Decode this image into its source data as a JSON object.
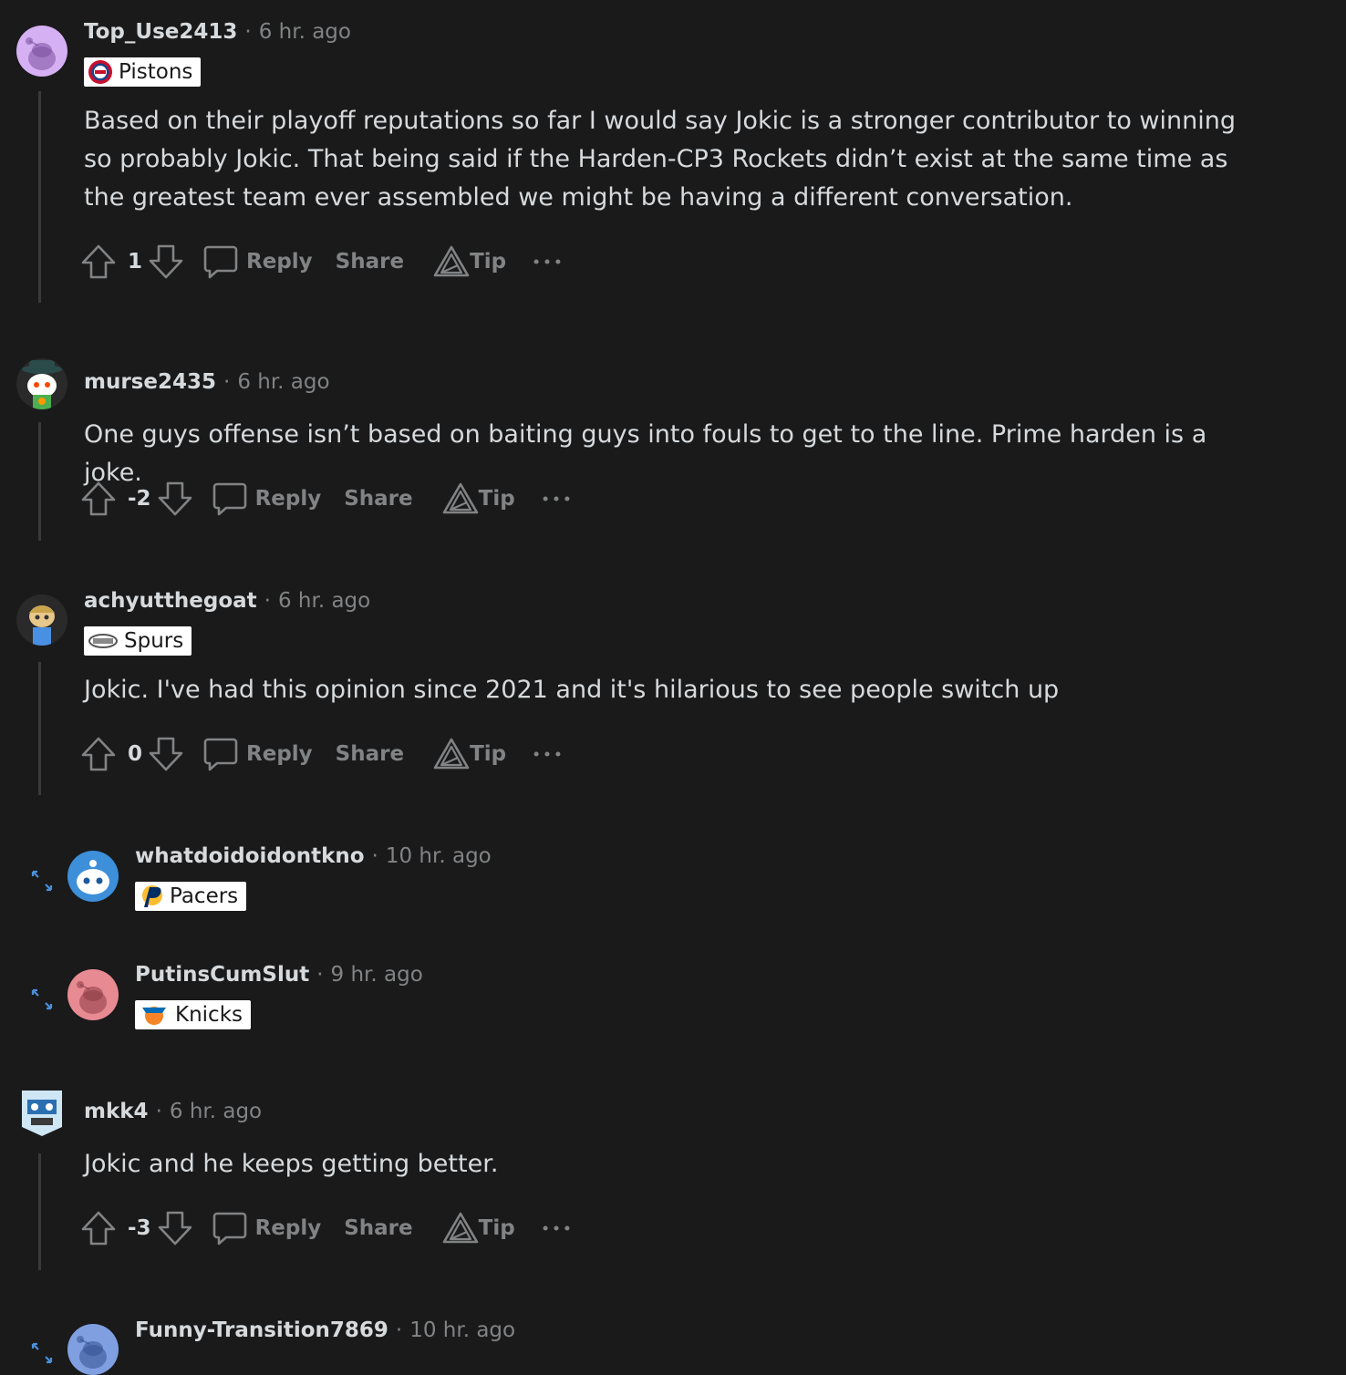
{
  "comments": [
    {
      "username": "Top_Use2413",
      "time": "6 hr. ago",
      "flair": "Pistons",
      "body": "Based on their playoff reputations so far I would say Jokic is a stronger contributor to winning so probably Jokic. That being said if the Harden-CP3 Rockets didn’t exist at the same time as the greatest team ever assembled we might be having a different conversation.",
      "score": "1",
      "reply_label": "Reply",
      "share_label": "Share",
      "tip_label": "Tip"
    },
    {
      "username": "murse2435",
      "time": "6 hr. ago",
      "body": "One guys offense isn’t based on baiting guys into fouls to get to the line. Prime harden is a joke.",
      "score": "-2",
      "reply_label": "Reply",
      "share_label": "Share",
      "tip_label": "Tip"
    },
    {
      "username": "achyutthegoat",
      "time": "6 hr. ago",
      "flair": "Spurs",
      "body": "Jokic. I've had this opinion since 2021 and it's hilarious to see people switch up",
      "score": "0",
      "reply_label": "Reply",
      "share_label": "Share",
      "tip_label": "Tip"
    },
    {
      "username": "whatdoidoidontkno",
      "time": "10 hr. ago",
      "flair": "Pacers"
    },
    {
      "username": "PutinsCumSlut",
      "time": "9 hr. ago",
      "flair": "Knicks"
    },
    {
      "username": "mkk4",
      "time": "6 hr. ago",
      "body": "Jokic and he keeps getting better.",
      "score": "-3",
      "reply_label": "Reply",
      "share_label": "Share",
      "tip_label": "Tip"
    },
    {
      "username": "Funny-Transition7869",
      "time": "10 hr. ago"
    }
  ],
  "colors": {
    "background": "#1a1a1b",
    "text": "#d7dadc",
    "muted": "#818384",
    "thread_line": "#3a3a3c"
  }
}
